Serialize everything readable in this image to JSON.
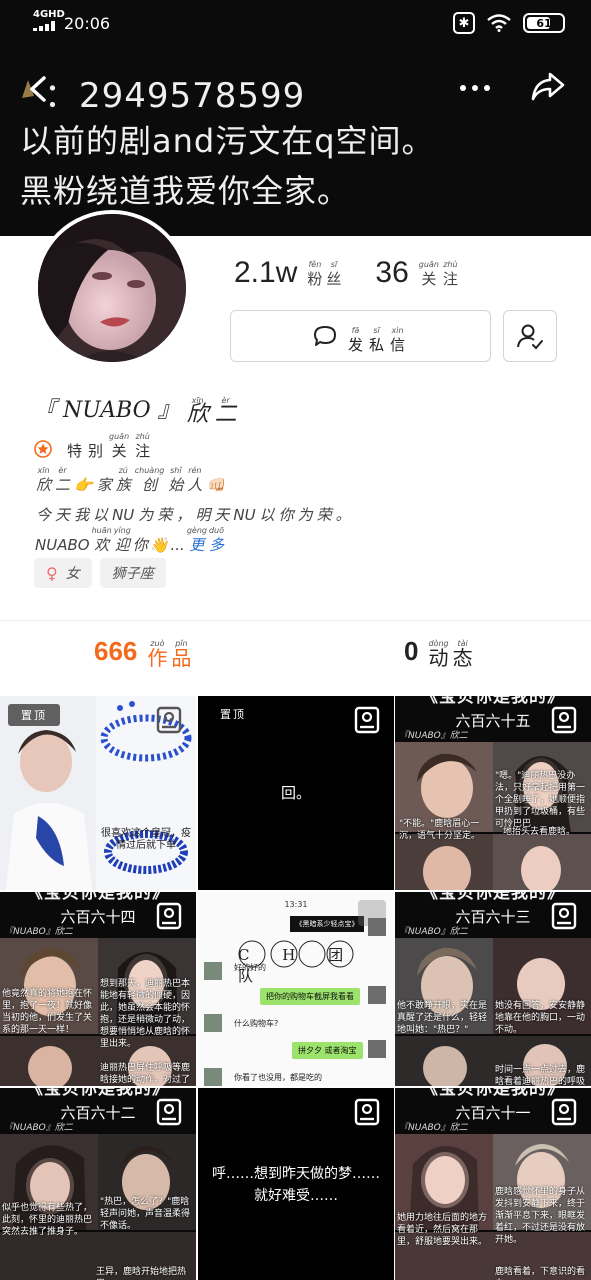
{
  "status_bar": {
    "network": "4GHD",
    "time": "20:06",
    "battery": "61"
  },
  "header": {
    "qq_id": "：2949578599",
    "signature": [
      "以前的剧and污文在q空间。",
      "黑粉绕道我爱你全家。"
    ]
  },
  "profile": {
    "fans_count": "2.1w",
    "fans_label": [
      [
        "fěn",
        "粉"
      ],
      [
        "sī",
        "丝"
      ]
    ],
    "follow_count": "36",
    "follow_label": [
      [
        "guān",
        "关"
      ],
      [
        "zhù",
        "注"
      ]
    ],
    "message_button": [
      [
        "fā",
        "发"
      ],
      [
        "sī",
        "私"
      ],
      [
        "xìn",
        "信"
      ]
    ],
    "name_left": "『 NUABO 』",
    "name_right": [
      [
        "xīn",
        "欣"
      ],
      [
        "èr",
        "二"
      ]
    ],
    "special_follow": [
      [
        "",
        "特"
      ],
      [
        "",
        "别"
      ],
      [
        "guān",
        "关"
      ],
      [
        "zhù",
        "注"
      ]
    ],
    "bio_line1": [
      [
        "xīn",
        "欣"
      ],
      [
        "èr",
        "二"
      ],
      [
        "",
        "👉"
      ],
      [
        "",
        "家"
      ],
      [
        "zú",
        "族"
      ],
      [
        "chuàng",
        "创"
      ],
      [
        "shǐ",
        "始"
      ],
      [
        "rén",
        "人"
      ],
      [
        "",
        "👊🏻"
      ]
    ],
    "bio_line2": [
      [
        "",
        "今"
      ],
      [
        "",
        "天"
      ],
      [
        "",
        "我"
      ],
      [
        "",
        "以"
      ],
      [
        "",
        "NU"
      ],
      [
        "",
        "为"
      ],
      [
        "",
        "荣"
      ],
      [
        "",
        "，"
      ],
      [
        "",
        "明"
      ],
      [
        "",
        "天"
      ],
      [
        "",
        "NU"
      ],
      [
        "",
        "以"
      ],
      [
        "",
        "你"
      ],
      [
        "",
        "为"
      ],
      [
        "",
        "荣"
      ],
      [
        "",
        "。"
      ]
    ],
    "bio_line3": [
      [
        "",
        "NUABO"
      ],
      [
        "huān",
        "欢"
      ],
      [
        "yíng",
        "迎"
      ],
      [
        "",
        "你"
      ],
      [
        "",
        "👋"
      ],
      [
        "",
        "..."
      ],
      [
        "gèng",
        "更"
      ],
      [
        "duō",
        "多"
      ]
    ],
    "gender_tag": "女",
    "zodiac_tag": "狮子座"
  },
  "tabs": {
    "works_count": "666",
    "works_label": [
      [
        "zuò",
        "作"
      ],
      [
        "pǐn",
        "品"
      ]
    ],
    "moments_count": "0",
    "moments_label": [
      [
        "dòng",
        "动"
      ],
      [
        "tài",
        "态"
      ]
    ]
  },
  "tiles": {
    "t1_badge": "置顶",
    "t1_caption": "很喜欢这个皇冠，疫情过后就下单",
    "t2_badge": "置顶",
    "t2_text": "回。",
    "t3_title": "六百六十五",
    "t3_brand": "『NUABO』欣二",
    "t3_cap1": "\"嗯。\"迪丽热巴没办法，只好拿起把用第一个全剧睡了，她顺便指甲扔到了垃圾桶，有些可怜巴巴",
    "t3_cap2": "\"不能。\"鹿晗眉心一沉，语气十分坚定。",
    "t3_cap3": "地抬头去看鹿晗。",
    "banner": "《宝贝你是我的》",
    "t4_title": "六百六十四",
    "t4_brand": "『NUABO』欣二",
    "t4_cap1": "他竟然真的将她抱在怀里，抱了一夜！就好像当初的他，们发生了关系的那一天一样！",
    "t4_cap2": "想到那天，迪丽热巴本能地有轻微的僵硬，因此，她虽然会本能的怀抱，还是稍微动了动，想要悄悄地从鹿晗的怀里出来。",
    "t4_cap3": "迪丽热巴屏住呼吸等鹿晗接她的动作，对过了他",
    "t5_time": "13:31",
    "t5_name": "C H 团 队",
    "t5_bubble1": "《黑暗系少轻点宝》",
    "t5_msg1": "好的好的",
    "t5_bubble2": "把你的购物车截屏我看看",
    "t5_msg2": "什么购物车?",
    "t5_bubble3": "拼夕夕 或者淘宝",
    "t5_msg3": "你看了也没用，都是吃的",
    "t6_title": "六百六十三",
    "t6_brand": "『NUABO』欣二",
    "t6_cap1": "他不敢睁开眼，实在是真醒了还是什么，轻轻地叫她：\"热巴？\"",
    "t6_cap2": "她没有回答，安安静静地靠在他的胸口，一动不动。",
    "t6_cap3": "时间一点一点过去，鹿晗看着迪丽热巴的呼吸逐渐",
    "t7_title": "六百六十二",
    "t7_brand": "『NUABO』欣二",
    "t7_cap1": "似乎也觉得有些热了，此刻，怀里的迪丽热巴突然去推了推身子。",
    "t7_cap2": "\"热巴，怎么了？\"鹿晗轻声问她，声音温柔得不像话。",
    "t7_cap3": "王异，鹿晗开始地把热巴",
    "t8_text": "呼……想到昨天做的梦……就好难受……",
    "t9_title": "六百六十一",
    "t9_brand": "『NUABO』欣二",
    "t9_cap1": "她用力地往后面的地方看着近，然后窝在那里，舒服地要哭出来。",
    "t9_cap2": "鹿晗感觉怀里的身子从发抖到安静下来，终于渐渐平息下来，眼眶发着红，不过还是没有放开她。",
    "t9_cap3": "鹿晗看着，下意识的看向"
  },
  "colors": {
    "header_bg": "#0b0b0b",
    "accent_orange": "#f26b1d",
    "text_dark": "#222222"
  }
}
